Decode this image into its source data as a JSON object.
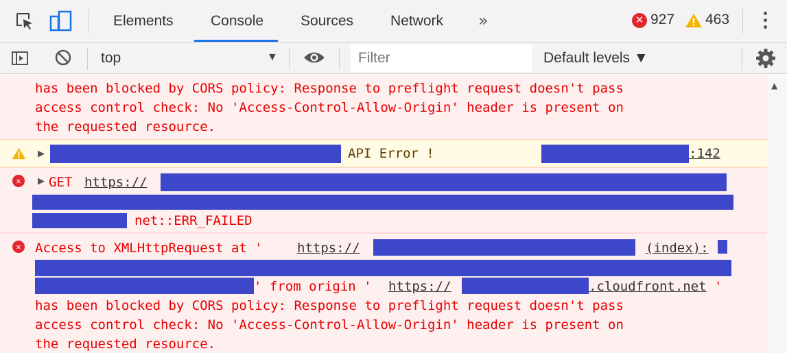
{
  "tabs": [
    {
      "label": "Elements"
    },
    {
      "label": "Console"
    },
    {
      "label": "Sources"
    },
    {
      "label": "Network"
    }
  ],
  "more_tabs": "»",
  "counts": {
    "errors": "927",
    "warnings": "463"
  },
  "toolbar": {
    "context": "top",
    "context_arrow": "▼",
    "filter_placeholder": "Filter",
    "levels": "Default levels ▼"
  },
  "log": {
    "msg1": {
      "lines": [
        "has been blocked by CORS policy: Response to preflight request doesn't pass",
        "access control check: No 'Access-Control-Allow-Origin' header is present on",
        "the requested resource."
      ]
    },
    "msg2": {
      "text": "API Error !",
      "source_line": ":142"
    },
    "msg3": {
      "method": "GET",
      "url_prefix": "https://",
      "error": "net::ERR_FAILED"
    },
    "msg4": {
      "prefix": "Access to XMLHttpRequest at '",
      "url_prefix": "https://",
      "source": "(index):",
      "from_origin": "' from origin '",
      "origin_prefix": "https://",
      "origin_suffix": ".cloudfront.net",
      "quote_end": "'",
      "lines": [
        "has been blocked by CORS policy: Response to preflight request doesn't pass",
        "access control check: No 'Access-Control-Allow-Origin' header is present on",
        "the requested resource."
      ]
    }
  },
  "colors": {
    "accent": "#1a73e8",
    "error": "#e60000",
    "redaction": "#3c47c9"
  }
}
